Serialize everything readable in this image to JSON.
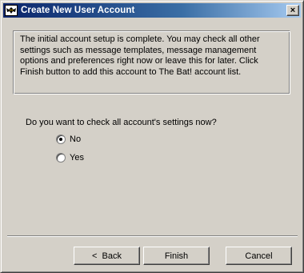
{
  "window": {
    "title": "Create New User Account",
    "close_glyph": "×"
  },
  "info": {
    "text": "The initial account setup is complete. You may check all other settings such as message templates, message management options and preferences right now or leave this for later. Click Finish button to add this account to The Bat! account list."
  },
  "question": {
    "label": "Do you want to check all account's settings now?",
    "options": [
      {
        "label": "No",
        "checked": true
      },
      {
        "label": "Yes",
        "checked": false
      }
    ]
  },
  "buttons": {
    "back_chevron": "<",
    "back_label": "Back",
    "finish_label": "Finish",
    "cancel_label": "Cancel"
  },
  "icons": {
    "app": "bat-app-icon",
    "close": "close-icon"
  },
  "colors": {
    "titlebar_start": "#0a246a",
    "titlebar_end": "#a6caf0",
    "face": "#d4d0c8"
  }
}
